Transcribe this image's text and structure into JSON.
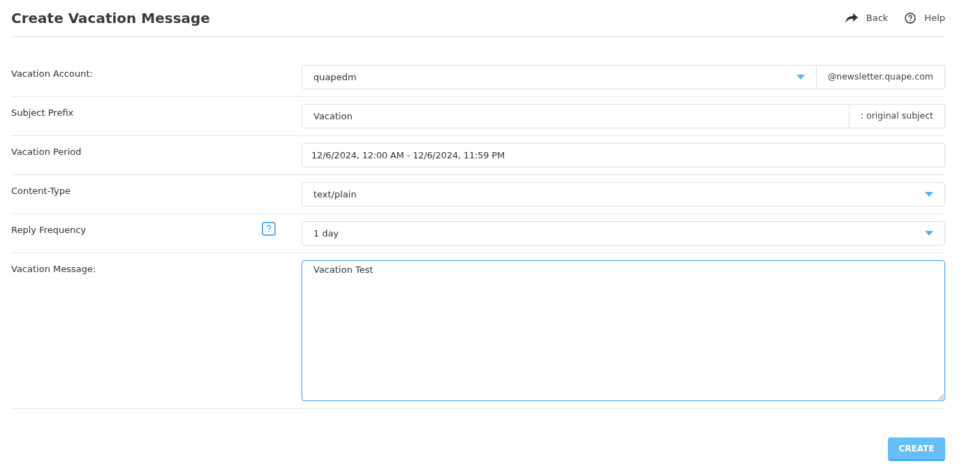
{
  "title": "Create Vacation Message",
  "header_links": [
    {
      "kind": "back",
      "label": "Back"
    },
    {
      "kind": "help",
      "label": "Help"
    }
  ],
  "fields": [
    {
      "kind": "select",
      "label": "Vacation Account:",
      "value": "quapedm",
      "suffix": "@newsletter.quape.com",
      "help": false
    },
    {
      "kind": "text",
      "label": "Subject Prefix",
      "value": "Vacation",
      "suffix": ": original subject",
      "help": false
    },
    {
      "kind": "daterange",
      "label": "Vacation Period",
      "value": "12/6/2024, 12:00 AM - 12/6/2024, 11:59 PM",
      "help": false
    },
    {
      "kind": "select",
      "label": "Content-Type",
      "value": "text/plain",
      "help": false
    },
    {
      "kind": "select",
      "label": "Reply Frequency",
      "value": "1 day",
      "help": true
    },
    {
      "kind": "textarea",
      "label": "Vacation Message:",
      "value": "Vacation Test",
      "help": false,
      "focused": true
    }
  ],
  "create_button": {
    "label": "CREATE",
    "disabled": true
  }
}
